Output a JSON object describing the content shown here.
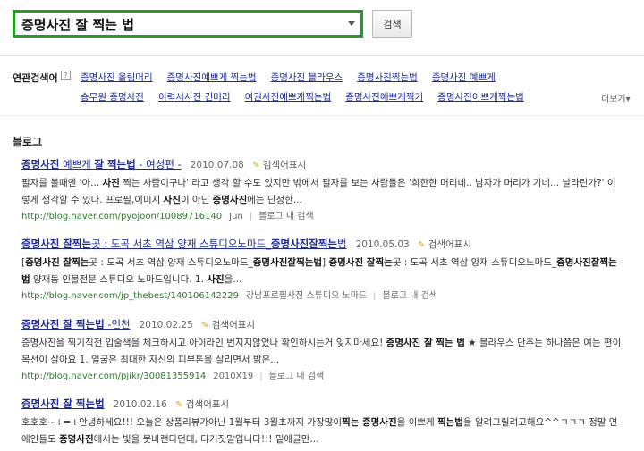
{
  "search": {
    "query": "증명사진 잘 찍는 법",
    "button_label": "검색"
  },
  "related": {
    "title": "연관검색어",
    "help_glyph": "?",
    "row1": [
      "증명사진 올림머리",
      "증명사진예쁘게 찍는법",
      "증명사진 블라우스",
      "증명사진찍는법",
      "증명사진 예쁘게"
    ],
    "row2": [
      "승무원 증명사진",
      "이력서사진 긴머리",
      "여권사진예쁘게찍는법",
      "증명사진예쁘게찍기",
      "증명사진이쁘게찍는법"
    ],
    "more_label": "더보기▾"
  },
  "blog": {
    "section_title": "블로그",
    "addr_label": "검색어표시",
    "blog_inner_label": "블로그 내 검색",
    "results": [
      {
        "title_a": "증명사진",
        "title_b": " 예쁘게 ",
        "title_c": "잘 찍는법",
        "title_d": " - 여성편 -",
        "date": "2010.07.08",
        "snippet": [
          {
            "t": "필자를 볼때엔 '아... ",
            "b": false
          },
          {
            "t": "사진",
            "b": true
          },
          {
            "t": " 찍는 사람이구나' 라고 생각 할 수도 있지만 밖에서 필자를 보는 사람들은 '희한한 머리네.. 남자가 머리가 기네... 날라린가?' 이렇게 생각할 수 있다. 프로필,이미지 ",
            "b": false
          },
          {
            "t": "사진",
            "b": true
          },
          {
            "t": "이 아닌 ",
            "b": false
          },
          {
            "t": "증명사진",
            "b": true
          },
          {
            "t": "에는 단정한...",
            "b": false
          }
        ],
        "url": "http://blog.naver.com/pyojoon/10089716140",
        "extra": "Jun"
      },
      {
        "title_a": "증명사진 잘찍는",
        "title_b": "곳 : 도곡 서초 역삼 양재 스튜디오노마드_",
        "title_c": "증명사진잘찍는",
        "title_d": "법",
        "date": "2010.05.03",
        "snippet": [
          {
            "t": "[",
            "b": false
          },
          {
            "t": "증명사진 잘찍는",
            "b": true
          },
          {
            "t": "곳 : 도곡 서초 역삼 양재 스튜디오노마드_",
            "b": false
          },
          {
            "t": "증명사진잘찍는법",
            "b": true
          },
          {
            "t": "] ",
            "b": false
          },
          {
            "t": "증명사진 잘찍는",
            "b": true
          },
          {
            "t": "곳 : 도곡 서초 역삼 양재 스튜디오노마드_",
            "b": false
          },
          {
            "t": "증명사진잘찍는법",
            "b": true
          },
          {
            "t": " 양재동 인물전문 스튜디오 노마드입니다. 1. ",
            "b": false
          },
          {
            "t": "사진",
            "b": true
          },
          {
            "t": "을...",
            "b": false
          }
        ],
        "url": "http://blog.naver.com/jp_thebest/140106142229",
        "extra": "강남프로필사진 스튜디오 노마드"
      },
      {
        "title_a": "증명사진 잘 찍는법",
        "title_b": " -인천",
        "title_c": "",
        "title_d": "",
        "date": "2010.02.25",
        "snippet": [
          {
            "t": "증명사진을 찍기직전 입술색을 체크하시고 아이라인 번지지않았나 확인하시는거 잊지마세요! ",
            "b": false
          },
          {
            "t": "증명사진 잘 찍는 법",
            "b": true
          },
          {
            "t": " ★ 블라우스 단추는 하나쯤은 여는 편이 목선이 살아요 1. 얼굴은 최대한 자신의 피부톤을 살리면서 밝은...",
            "b": false
          }
        ],
        "url": "http://blog.naver.com/pjikr/30081355914",
        "extra": "2010X19"
      },
      {
        "title_a": "증명사진 잘 찍는법",
        "title_b": "",
        "title_c": "",
        "title_d": "",
        "date": "2010.02.16",
        "snippet": [
          {
            "t": "호호호~+=+안녕하세요!!! 오늘은 상품리뷰가아닌 1월부터 3월초까지 가장많이",
            "b": false
          },
          {
            "t": "찍는 증명사진",
            "b": true
          },
          {
            "t": "을 이쁘게 ",
            "b": false
          },
          {
            "t": "찍는법",
            "b": true
          },
          {
            "t": "을 알려그릴려고해요^^ㅋㅋㅋ 정말 연애인들도 ",
            "b": false
          },
          {
            "t": "증명사진",
            "b": true
          },
          {
            "t": "에서는 빛을 못바랜다던데, 다거짓말입니다!!! 밑에글만...",
            "b": false
          }
        ],
        "url": "",
        "extra": ""
      }
    ]
  }
}
